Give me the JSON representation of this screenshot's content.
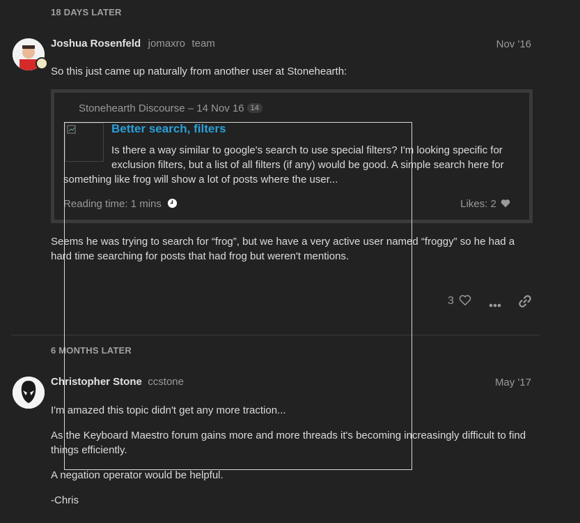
{
  "gaps": {
    "first": "18 DAYS LATER",
    "second": "6 MONTHS LATER"
  },
  "post1": {
    "name": "Joshua Rosenfeld",
    "username": "jomaxro",
    "title": "team",
    "date": "Nov '16",
    "intro": "So this just came up naturally from another user at Stonehearth:",
    "onebox": {
      "source": "Stonehearth Discourse – 14 Nov 16",
      "count": "14",
      "title": "Better search, filters",
      "excerpt_line1": "Is there a way similar to google's search to use special filters? I'm looking specific for",
      "excerpt_line2": "exclusion filters, but a list of all filters (if any) would be good. A simple search here for",
      "excerpt_line3": "something like frog will show a lot of posts where the user...",
      "reading_time": "Reading time: 1 mins",
      "likes": "Likes: 2"
    },
    "followup_line1": "Seems he was trying to search for “frog”, but we have a very active user named “froggy” so he had a",
    "followup_line2": "hard time searching for posts that had frog but weren't mentions.",
    "like_count": "3"
  },
  "post2": {
    "name": "Christopher Stone",
    "username": "ccstone",
    "date": "May '17",
    "p1": "I'm amazed this topic didn't get any more traction...",
    "p2_line1": "As the Keyboard Maestro forum gains more and more threads it's becoming increasingly difficult to find",
    "p2_line2": "things efficiently.",
    "p3": "A negation operator would be helpful.",
    "p4": "-Chris"
  },
  "icons": {
    "clock": "clock-icon",
    "heart": "heart-icon",
    "more": "more-icon",
    "link": "link-icon"
  },
  "colors": {
    "background": "#222222",
    "link": "#2a9fd8",
    "muted": "#9a9a9a"
  }
}
